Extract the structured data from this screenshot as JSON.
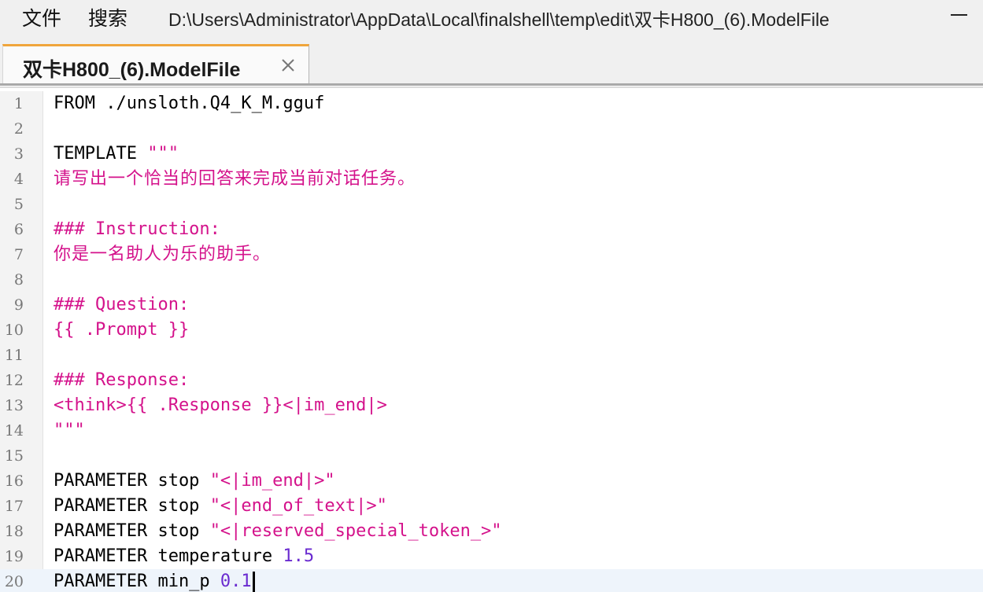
{
  "menu": {
    "file_label": "文件",
    "search_label": "搜索"
  },
  "window": {
    "path": "D:\\Users\\Administrator\\AppData\\Local\\finalshell\\temp\\edit\\双卡H800_(6).ModelFile"
  },
  "tab": {
    "title": "双卡H800_(6).ModelFile",
    "close_icon": "close-icon"
  },
  "colors": {
    "string_accent": "#d4128b",
    "number_accent": "#6a2bd0",
    "tab_accent": "#f0a53c"
  },
  "editor": {
    "lines": [
      {
        "num": "1",
        "parts": [
          {
            "t": "FROM ./unsloth.Q4_K_M.gguf"
          }
        ]
      },
      {
        "num": "2",
        "parts": []
      },
      {
        "num": "3",
        "parts": [
          {
            "t": "TEMPLATE "
          },
          {
            "t": "\"\"\"",
            "c": "pink"
          }
        ]
      },
      {
        "num": "4",
        "parts": [
          {
            "t": "请写出一个恰当的回答来完成当前对话任务。",
            "c": "pink",
            "cjk": true
          }
        ]
      },
      {
        "num": "5",
        "parts": []
      },
      {
        "num": "6",
        "parts": [
          {
            "t": "### Instruction:",
            "c": "pink"
          }
        ]
      },
      {
        "num": "7",
        "parts": [
          {
            "t": "你是一名助人为乐的助手。",
            "c": "pink",
            "cjk": true
          }
        ]
      },
      {
        "num": "8",
        "parts": []
      },
      {
        "num": "9",
        "parts": [
          {
            "t": "### Question:",
            "c": "pink"
          }
        ]
      },
      {
        "num": "10",
        "parts": [
          {
            "t": "{{ .Prompt }}",
            "c": "pink"
          }
        ]
      },
      {
        "num": "11",
        "parts": []
      },
      {
        "num": "12",
        "parts": [
          {
            "t": "### Response:",
            "c": "pink"
          }
        ]
      },
      {
        "num": "13",
        "parts": [
          {
            "t": "<think>{{ .Response }}<|im_end|>",
            "c": "pink"
          }
        ]
      },
      {
        "num": "14",
        "parts": [
          {
            "t": "\"\"\"",
            "c": "pink"
          }
        ]
      },
      {
        "num": "15",
        "parts": []
      },
      {
        "num": "16",
        "parts": [
          {
            "t": "PARAMETER stop "
          },
          {
            "t": "\"<|im_end|>\"",
            "c": "pink"
          }
        ]
      },
      {
        "num": "17",
        "parts": [
          {
            "t": "PARAMETER stop "
          },
          {
            "t": "\"<|end_of_text|>\"",
            "c": "pink"
          }
        ]
      },
      {
        "num": "18",
        "parts": [
          {
            "t": "PARAMETER stop "
          },
          {
            "t": "\"<|reserved_special_token_>\"",
            "c": "pink"
          }
        ]
      },
      {
        "num": "19",
        "parts": [
          {
            "t": "PARAMETER temperature "
          },
          {
            "t": "1.5",
            "c": "purple"
          }
        ]
      },
      {
        "num": "20",
        "parts": [
          {
            "t": "PARAMETER min_p "
          },
          {
            "t": "0.1",
            "c": "purple"
          }
        ],
        "current": true,
        "caret": true
      }
    ]
  }
}
